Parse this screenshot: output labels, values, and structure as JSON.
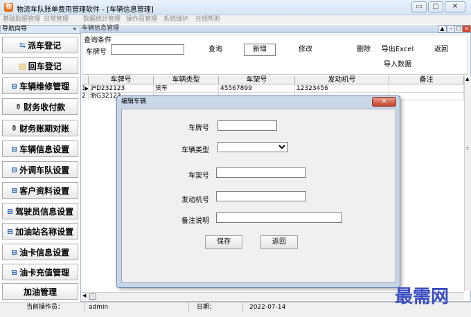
{
  "window": {
    "title": "物流车队账单费用管理软件  - [车辆信息管理]",
    "buttons": [
      "▭",
      "▢",
      "✕"
    ]
  },
  "menu": [
    "基础数据管理",
    "日常管理",
    "数据统计管理",
    "操作员管理",
    "系统维护",
    "在线帮助"
  ],
  "nav": {
    "header": "导航向导",
    "collapse": "«",
    "items": [
      {
        "label": "派车登记",
        "icon": "truck-dispatch-icon"
      },
      {
        "label": "回车登记",
        "icon": "folder-icon"
      },
      {
        "label": "车辆维修管理",
        "icon": "window-icon"
      },
      {
        "label": "财务收付款",
        "icon": "money-bag-icon"
      },
      {
        "label": "财务账期对账",
        "icon": "money-bag-icon"
      },
      {
        "label": "车辆信息设置",
        "icon": "window-icon"
      },
      {
        "label": "外调车队设置",
        "icon": "window-icon"
      },
      {
        "label": "客户资料设置",
        "icon": "window-icon"
      },
      {
        "label": "驾驶员信息设置",
        "icon": "window-icon"
      },
      {
        "label": "加油站名称设置",
        "icon": "window-icon"
      },
      {
        "label": "油卡信息设置",
        "icon": "window-icon"
      },
      {
        "label": "油卡充值管理",
        "icon": "window-icon"
      },
      {
        "label": "加油管理",
        "icon": ""
      }
    ]
  },
  "child": {
    "title": "车辆信息管理",
    "mdi_buttons": [
      "▲",
      "–",
      "☐",
      "✕"
    ]
  },
  "query": {
    "group_label": "查询条件",
    "plate_label": "车牌号",
    "plate_value": "",
    "buttons": {
      "search": "查询",
      "add": "新增",
      "edit": "修改",
      "delete": "删除",
      "export": "导出Excel",
      "back": "返回",
      "import": "导入数据"
    }
  },
  "grid": {
    "columns": [
      "车牌号",
      "车辆类型",
      "车架号",
      "发动机号",
      "备注"
    ],
    "rows": [
      {
        "num": "1",
        "marker": "▶",
        "plate": "沪D232123",
        "type": "货车",
        "frame": "45567899",
        "engine": "12323456",
        "note": ""
      },
      {
        "num": "2",
        "marker": "",
        "plate": "浙G32123",
        "type": "",
        "frame": "",
        "engine": "",
        "note": ""
      }
    ]
  },
  "status": {
    "operator_label": "当前操作员：",
    "operator": "admin",
    "date_label": "日期：",
    "date": "2022-07-14"
  },
  "dialog": {
    "title": "编辑车辆",
    "close": "✕",
    "fields": {
      "plate": {
        "label": "车牌号",
        "value": ""
      },
      "type": {
        "label": "车辆类型",
        "value": ""
      },
      "frame": {
        "label": "车架号",
        "value": ""
      },
      "engine": {
        "label": "发动机号",
        "value": ""
      },
      "note": {
        "label": "备注说明",
        "value": ""
      }
    },
    "save": "保存",
    "back": "返回"
  },
  "watermark": "最需网",
  "colors": {
    "watermark": "#3a4cc2",
    "dialog_frame": "#c8d6e8",
    "close_button": "#c4412b"
  }
}
